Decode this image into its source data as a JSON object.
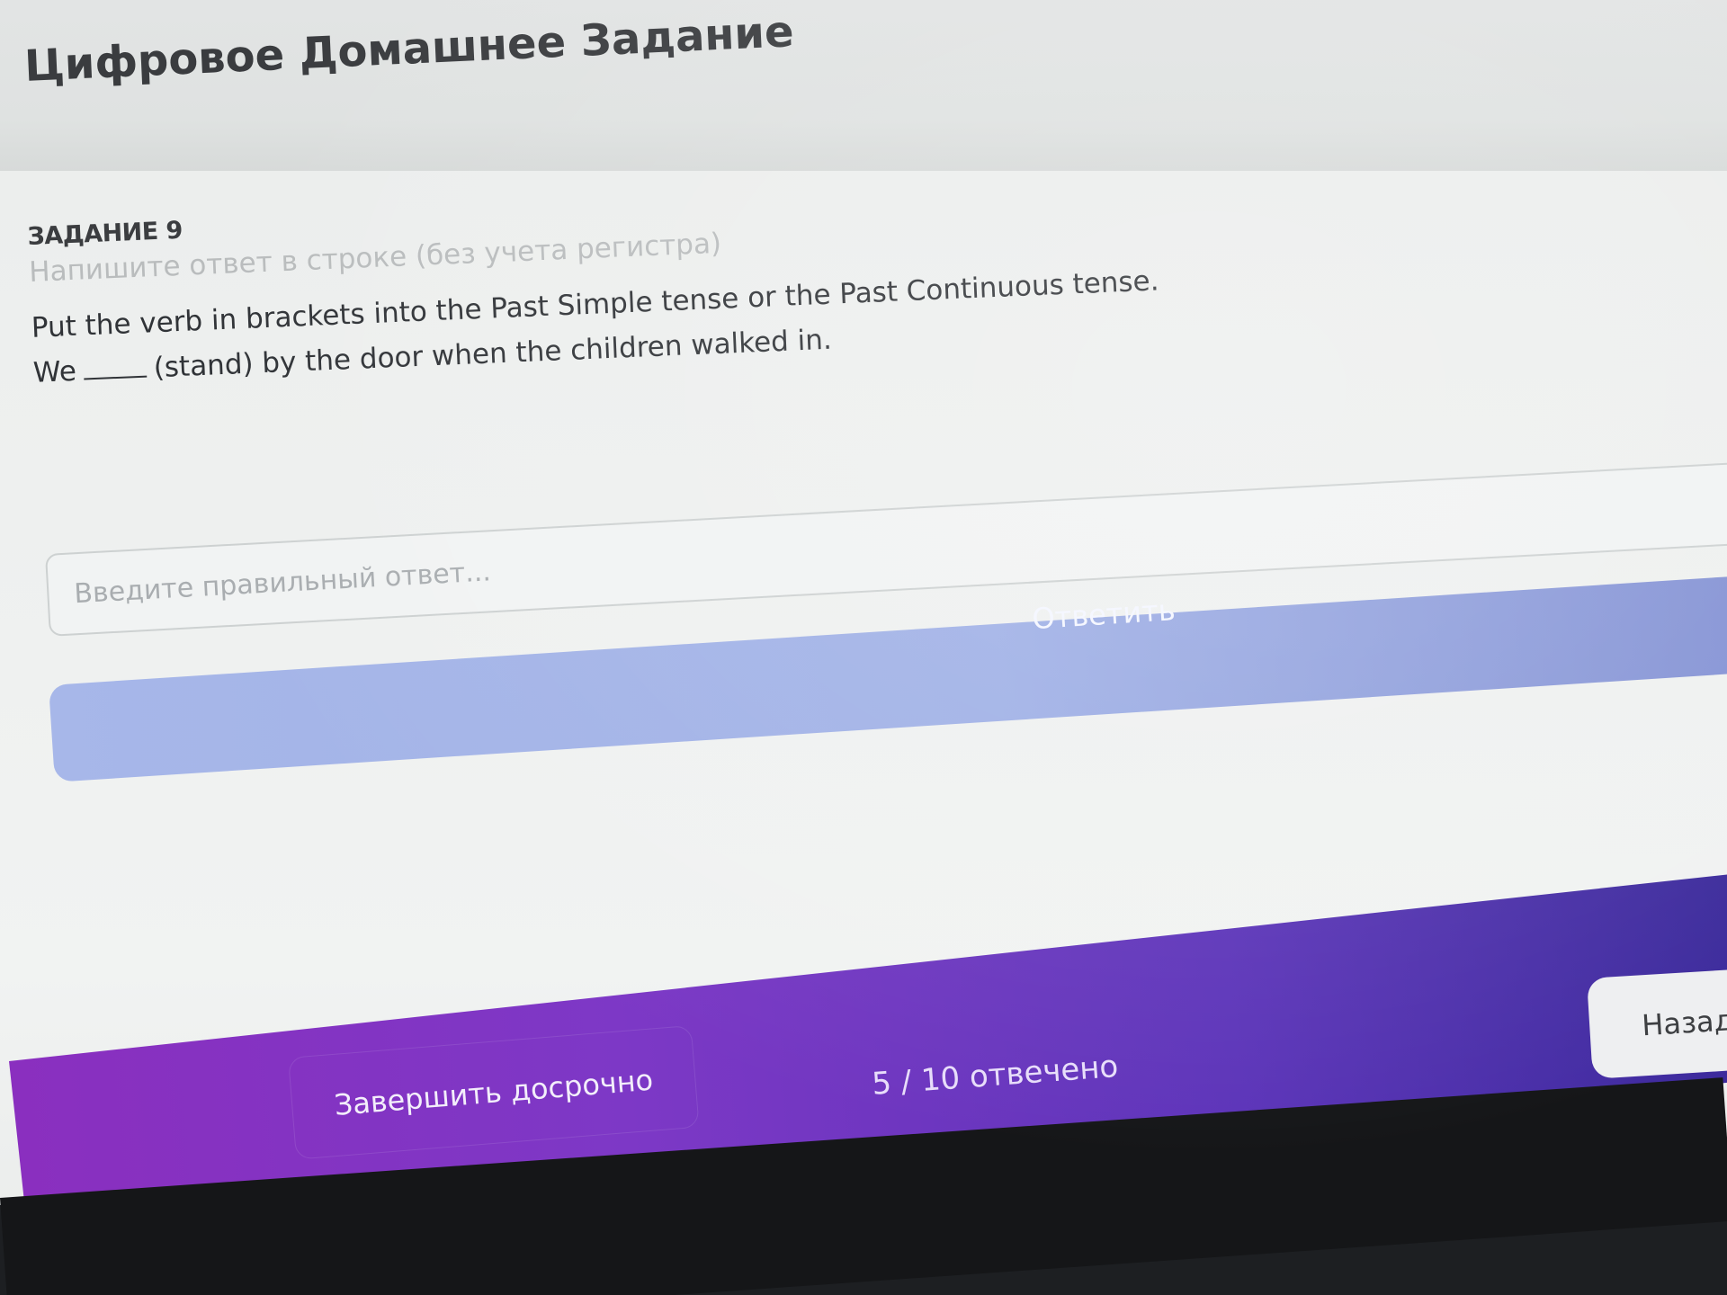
{
  "header": {
    "title": "Цифровое Домашнее Задание"
  },
  "task": {
    "number_label": "ЗАДАНИЕ 9",
    "instruction": "Напишите ответ в строке (без учета регистра)",
    "question": "Put the verb in brackets into the Past Simple tense or the Past Continuous tense.",
    "sentence_start": "We",
    "sentence_end": "(stand) by the door when the children walked in."
  },
  "answer": {
    "placeholder": "Введите правильный ответ...",
    "value": ""
  },
  "submit": {
    "label": "Ответить"
  },
  "footer": {
    "finish_early_label": "Завершить досрочно",
    "progress_text": "5 / 10 отвечено",
    "back_label": "Назад"
  },
  "colors": {
    "submit_button": "#a3b3e8",
    "footer_gradient_start": "#8a2fbf",
    "footer_gradient_end": "#3a2a9a",
    "back_button": "#eeeff1"
  }
}
